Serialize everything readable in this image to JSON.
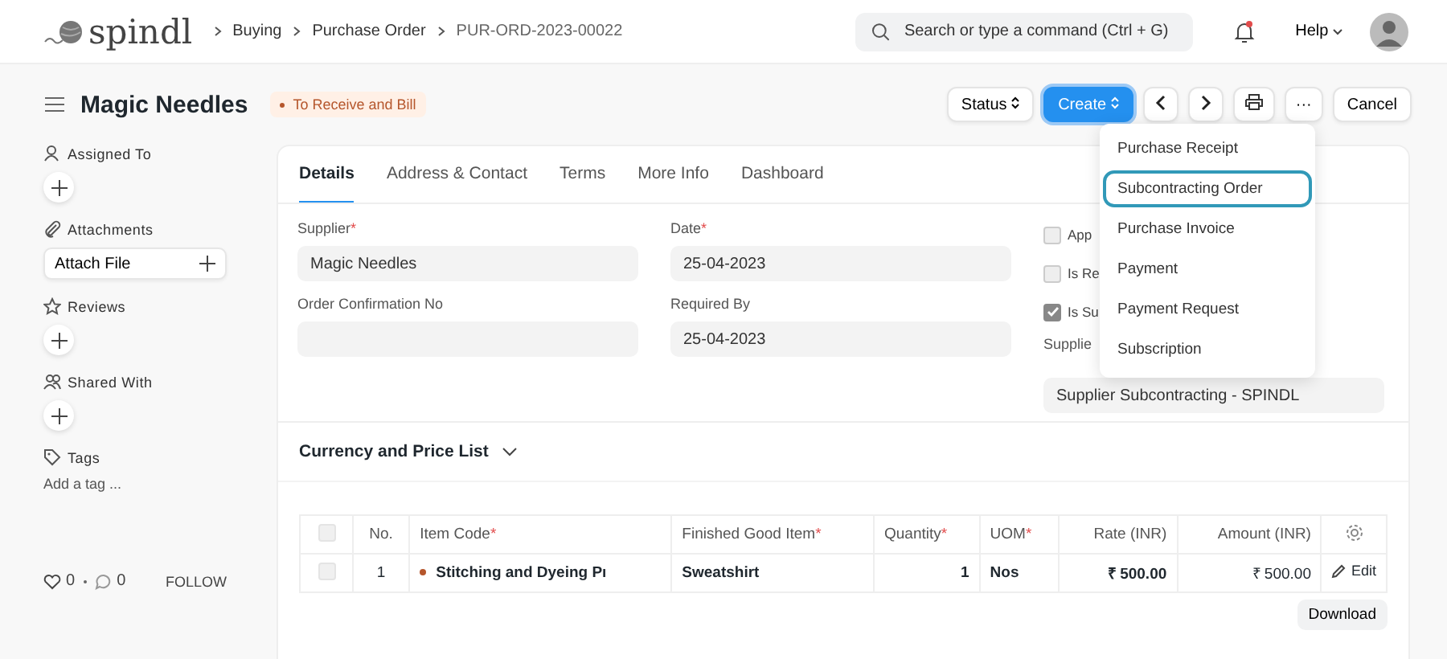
{
  "navbar": {
    "logo": "spindl",
    "breadcrumbs": [
      "Buying",
      "Purchase Order",
      "PUR-ORD-2023-00022"
    ],
    "search": {
      "placeholder": "Search or type a command (Ctrl + G)"
    },
    "help": "Help",
    "notification": true
  },
  "page": {
    "title": "Magic Needles",
    "status": "To Receive and Bill",
    "actions": [
      {
        "kind": "select",
        "label": "Status"
      },
      {
        "kind": "primary",
        "label": "Create",
        "selected": true
      },
      {
        "kind": "prev"
      },
      {
        "kind": "next"
      },
      {
        "kind": "print"
      },
      {
        "kind": "more",
        "label": "···"
      },
      {
        "kind": "plain",
        "label": "Cancel"
      }
    ]
  },
  "sidebar": {
    "sections": [
      {
        "kind": "assign",
        "title": "Assigned To"
      },
      {
        "kind": "attach",
        "title": "Attachments",
        "button": "Attach File"
      },
      {
        "kind": "review",
        "title": "Reviews"
      },
      {
        "kind": "share",
        "title": "Shared With"
      },
      {
        "kind": "tag",
        "title": "Tags",
        "link": "Add a tag ..."
      }
    ],
    "likes": "0",
    "comments": "0",
    "follow": "FOLLOW"
  },
  "tabs": [
    {
      "label": "Details",
      "selected": true
    },
    {
      "label": "Address & Contact",
      "selected": false
    },
    {
      "label": "Terms",
      "selected": false
    },
    {
      "label": "More Info",
      "selected": false
    },
    {
      "label": "Dashboard",
      "selected": false
    }
  ],
  "form": {
    "col1": [
      {
        "label": "Supplier",
        "mark": "*",
        "value": "Magic Needles"
      },
      {
        "label": "Order Confirmation No"
      }
    ],
    "col2": [
      {
        "label": "Date",
        "mark": "*",
        "value": "25-04-2023"
      },
      {
        "label": "Required By",
        "value": "25-04-2023"
      }
    ],
    "checks": [
      {
        "label": "App",
        "checked": false
      },
      {
        "label": "Is Re",
        "checked": false
      },
      {
        "label": "Is Su",
        "checked": true
      }
    ],
    "col3_field": {
      "label": "Supplie",
      "value": "Supplier Subcontracting - SPINDL"
    }
  },
  "section": {
    "title": "Currency and Price List",
    "expanded": false
  },
  "table": {
    "all_selected": false,
    "columns": [
      {
        "label": "No."
      },
      {
        "label": "Item Code",
        "mark": "*"
      },
      {
        "label": "Finished Good Item",
        "mark": "*"
      },
      {
        "label": "Quantity",
        "mark": "*"
      },
      {
        "label": "UOM",
        "mark": "*"
      },
      {
        "label": "Rate (INR)"
      },
      {
        "label": "Amount (INR)"
      }
    ],
    "rows": [
      {
        "selected": false,
        "cells": [
          "1",
          "Stitching and Dyeing Pı",
          "Sweatshirt",
          "1",
          "Nos",
          "₹ 500.00",
          "₹ 500.00"
        ],
        "edit": "Edit"
      }
    ],
    "download": "Download"
  },
  "menu": {
    "items": [
      {
        "label": "Purchase Receipt",
        "selected": false
      },
      {
        "label": "Subcontracting Order",
        "selected": true
      },
      {
        "label": "Purchase Invoice",
        "selected": false
      },
      {
        "label": "Payment",
        "selected": false
      },
      {
        "label": "Payment Request",
        "selected": false
      },
      {
        "label": "Subscription",
        "selected": false
      }
    ]
  }
}
